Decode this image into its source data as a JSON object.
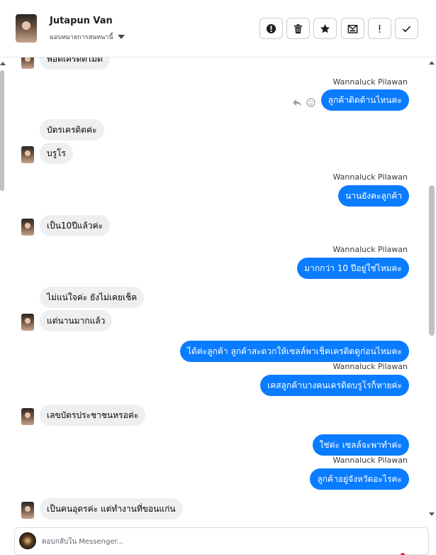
{
  "header": {
    "contact_name": "Jutapun Van",
    "assign_label": "มอบหมายการสนทนานี้",
    "toolbar": [
      {
        "icon": "alert-circle-icon",
        "name": "mark-spam-button"
      },
      {
        "icon": "trash-icon",
        "name": "delete-button"
      },
      {
        "icon": "star-icon",
        "name": "star-button"
      },
      {
        "icon": "mail-unread-icon",
        "name": "mark-unread-button"
      },
      {
        "icon": "exclamation-icon",
        "name": "follow-up-button"
      },
      {
        "icon": "check-icon",
        "name": "mark-done-button"
      }
    ]
  },
  "messages": {
    "m0": "พอดีเครดิตไม่ดี",
    "s1": "Wannaluck Pilawan",
    "m1": "ลูกค้าติดด้านไหนคะ",
    "m2": "บัตรเครดิตค่ะ",
    "m3": "บรูโร",
    "s4": "Wannaluck Pilawan",
    "m4": "นานยังคะลูกค้า",
    "m5": "เป็น10ปีแล้วค่ะ",
    "s6": "Wannaluck Pilawan",
    "m6": "มากกว่า 10 ปีอยู่ใช่ไหมคะ",
    "m7": "ไม่แน่ใจค่ะ ยังไม่เคยเช็ค",
    "m8": "แต่นานมากแล้ว",
    "m9": "ได้ค่ะลูกค้า  ลูกค้าสะดวกให้เซลล์พาเช็คเครดิตดูก่อนไหมคะ",
    "s10": "Wannaluck Pilawan",
    "m10": "เคสลูกค้าบางคนเครดิตบรูโรก็หายค่ะ",
    "m11": "เลขบัตรประชาชนหรอค่ะ",
    "m12": "ใช่ค่ะ  เซลล์จะพาทำค่ะ",
    "s13": "Wannaluck Pilawan",
    "m13": "ลูกค้าอยู่จังหวัดอะไรคะ",
    "m14": "เป็นคนอุดรค่ะ แต่ทำงานที่ขอนแก่น"
  },
  "composer": {
    "placeholder": "ตอบกลับใน Messenger..."
  },
  "colors": {
    "outgoing": "#0a7cff",
    "incoming": "#eeeff1"
  }
}
